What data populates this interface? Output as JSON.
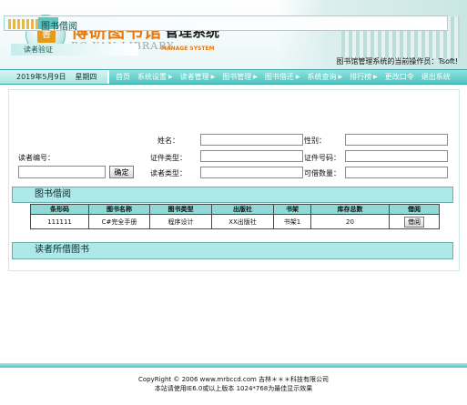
{
  "header": {
    "logo_glyph": "書",
    "title_cn": "博研图书馆",
    "title_system": "管理系统",
    "title_en": "BO YAN LIBRARY",
    "title_en_sub": "MANAGE SYSTEM",
    "operator_label": "图书馆管理系统的当前操作员：",
    "operator_name": "Tsoft!"
  },
  "nav": {
    "date": "2019年5月9日",
    "weekday": "星期四",
    "items": [
      {
        "label": "首页"
      },
      {
        "label": "系统设置"
      },
      {
        "label": "读者管理"
      },
      {
        "label": "图书管理"
      },
      {
        "label": "图书借还"
      },
      {
        "label": "系统查询"
      },
      {
        "label": "排行榜"
      },
      {
        "label": "更改口令"
      },
      {
        "label": "退出系统"
      }
    ]
  },
  "page": {
    "title": "图书借阅"
  },
  "reader": {
    "section_label": "读者验证",
    "id_label": "读者编号：",
    "id_value": "",
    "confirm_label": "确定",
    "name_label": "姓名：",
    "gender_label": "性别：",
    "cert_type_label": "证件类型：",
    "cert_no_label": "证件号码：",
    "reader_type_label": "读者类型：",
    "borrow_quota_label": "可借数量："
  },
  "borrow_section": {
    "title": "图书借阅",
    "columns": [
      "条形码",
      "图书名称",
      "图书类型",
      "出版社",
      "书架",
      "库存总数",
      "借阅"
    ],
    "rows": [
      {
        "barcode": "111111",
        "name": "C#完全手册",
        "type": "程序设计",
        "publisher": "XX出版社",
        "shelf": "书架1",
        "stock": "20",
        "action": "借阅"
      }
    ]
  },
  "borrowed_section": {
    "title": "读者所借图书"
  },
  "footer": {
    "copyright": "CopyRight © 2006 www.mrbccd.com 吉林＊＊＊科技有限公司",
    "note": "本站请使用IE6.0或以上版本 1024*768为最佳显示效果"
  },
  "colors": {
    "accent": "#4fc4c0",
    "section_bg": "#aee9e9",
    "header_orange": "#e8780c"
  }
}
